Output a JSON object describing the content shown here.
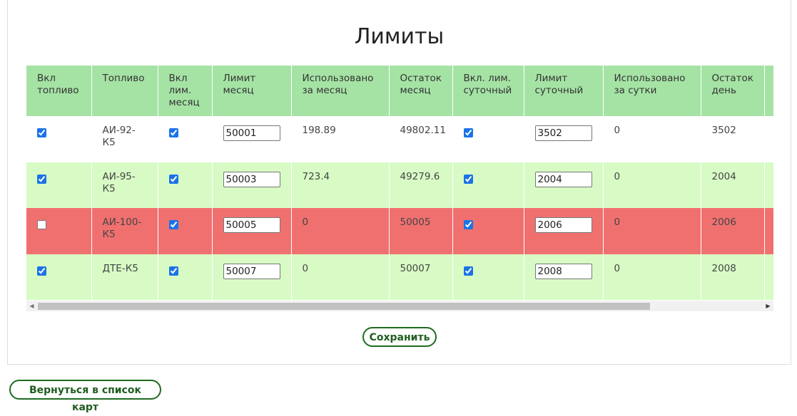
{
  "title": "Лимиты",
  "table": {
    "headers": [
      "Вкл топливо",
      "Топливо",
      "Вкл лим. месяц",
      "Лимит месяц",
      "Использовано за месяц",
      "Остаток месяц",
      "Вкл. лим. суточный",
      "Лимит суточный",
      "Использовано за сутки",
      "Остаток день",
      ""
    ],
    "rows": [
      {
        "fuel_on": true,
        "fuel": "АИ-92-К5",
        "month_limit_on": true,
        "month_limit": "50001",
        "used_month": "198.89",
        "rest_month": "49802.11",
        "day_limit_on": true,
        "day_limit": "3502",
        "used_day": "0",
        "rest_day": "3502",
        "status": "normal"
      },
      {
        "fuel_on": true,
        "fuel": "АИ-95-К5",
        "month_limit_on": true,
        "month_limit": "50003",
        "used_month": "723.4",
        "rest_month": "49279.6",
        "day_limit_on": true,
        "day_limit": "2004",
        "used_day": "0",
        "rest_day": "2004",
        "status": "normal"
      },
      {
        "fuel_on": false,
        "fuel": "АИ-100-К5",
        "month_limit_on": true,
        "month_limit": "50005",
        "used_month": "0",
        "rest_month": "50005",
        "day_limit_on": true,
        "day_limit": "2006",
        "used_day": "0",
        "rest_day": "2006",
        "status": "disabled"
      },
      {
        "fuel_on": true,
        "fuel": "ДТЕ-К5",
        "month_limit_on": true,
        "month_limit": "50007",
        "used_month": "0",
        "rest_month": "50007",
        "day_limit_on": true,
        "day_limit": "2008",
        "used_day": "0",
        "rest_day": "2008",
        "status": "normal"
      }
    ]
  },
  "buttons": {
    "save": "Сохранить",
    "back": "Вернуться в список карт"
  },
  "colors": {
    "header_bg": "#a5e3a5",
    "row_alt_bg": "#d8fbc5",
    "row_disabled_bg": "#f07070",
    "button_border": "#1f6b1f"
  }
}
